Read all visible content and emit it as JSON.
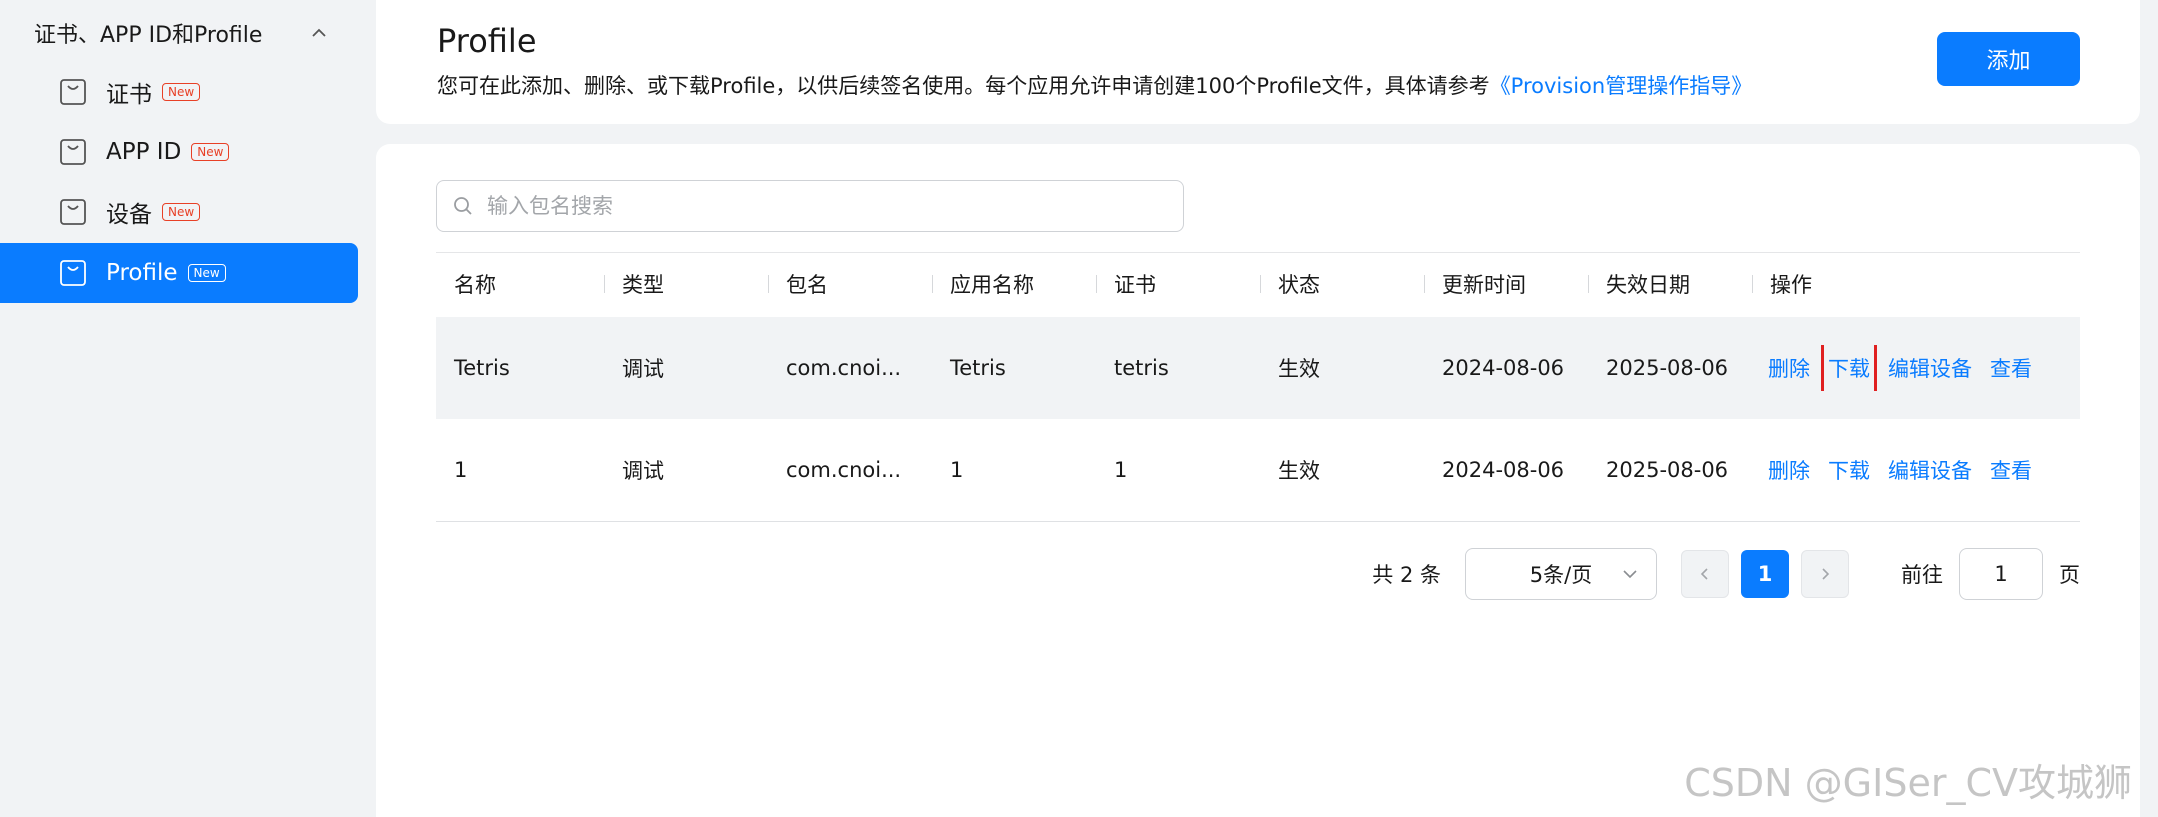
{
  "sidebar": {
    "group_label": "证书、APP ID和Profile",
    "items": [
      {
        "label": "证书",
        "badge": "New"
      },
      {
        "label": "APP ID",
        "badge": "New"
      },
      {
        "label": "设备",
        "badge": "New"
      },
      {
        "label": "Profile",
        "badge": "New",
        "active": true
      }
    ]
  },
  "header": {
    "title": "Profile",
    "description": "您可在此添加、删除、或下载Profile，以供后续签名使用。每个应用允许申请创建100个Profile文件，具体请参考",
    "guide_link": "《Provision管理操作指导》",
    "add_label": "添加"
  },
  "search": {
    "placeholder": "输入包名搜索",
    "value": ""
  },
  "table": {
    "columns": [
      "名称",
      "类型",
      "包名",
      "应用名称",
      "证书",
      "状态",
      "更新时间",
      "失效日期",
      "操作"
    ],
    "rows": [
      {
        "name": "Tetris",
        "type": "调试",
        "package": "com.cnoi...",
        "app_name": "Tetris",
        "cert": "tetris",
        "status": "生效",
        "updated": "2024-08-06",
        "expires": "2025-08-06"
      },
      {
        "name": "1",
        "type": "调试",
        "package": "com.cnoi...",
        "app_name": "1",
        "cert": "1",
        "status": "生效",
        "updated": "2024-08-06",
        "expires": "2025-08-06"
      }
    ],
    "actions": {
      "delete": "删除",
      "download": "下载",
      "edit_devices": "编辑设备",
      "view": "查看"
    }
  },
  "pagination": {
    "total": "共 2 条",
    "page_size": "5条/页",
    "current_page": "1",
    "goto_label": "前往",
    "goto_value": "1",
    "page_suffix": "页"
  },
  "watermark": "CSDN @GISer_CV攻城狮",
  "colors": {
    "accent": "#0a7cff",
    "badge_red": "#e84026",
    "highlight_red": "#e02020"
  }
}
